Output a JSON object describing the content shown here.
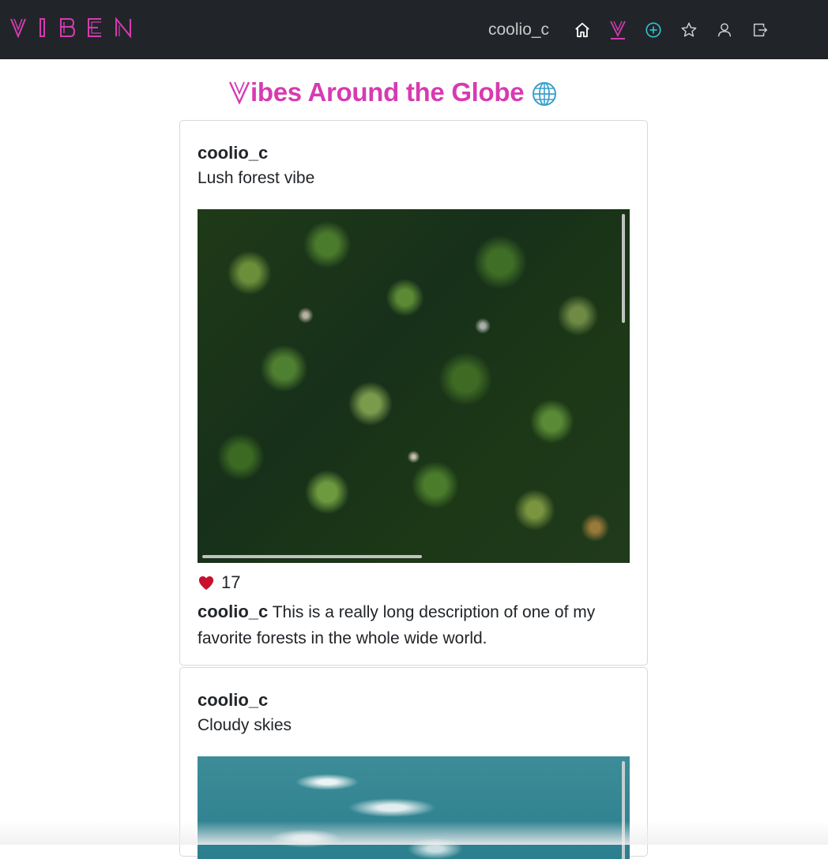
{
  "brand": {
    "logo_letters": [
      "V",
      "I",
      "B",
      "E",
      "N"
    ],
    "accent_color": "#d63bb2"
  },
  "nav": {
    "username": "coolio_c",
    "icons": [
      "home-icon",
      "vibe-icon",
      "add-post-icon",
      "star-icon",
      "profile-icon",
      "logout-icon"
    ]
  },
  "page": {
    "title": "ibes Around the Globe",
    "title_icon": "globe-icon"
  },
  "posts": [
    {
      "author": "coolio_c",
      "title": "Lush forest vibe",
      "image": "forest-aerial-image",
      "likes": "17",
      "caption_author": "coolio_c",
      "caption_text": " This is a really long description of one of my favorite forests in the whole wide world."
    },
    {
      "author": "coolio_c",
      "title": "Cloudy skies",
      "image": "cloudy-sky-image"
    }
  ],
  "colors": {
    "navbar_bg": "#212529",
    "title_pink": "#d63bb2",
    "add_icon_teal": "#2fc4d4",
    "heart_red": "#c8102e"
  }
}
